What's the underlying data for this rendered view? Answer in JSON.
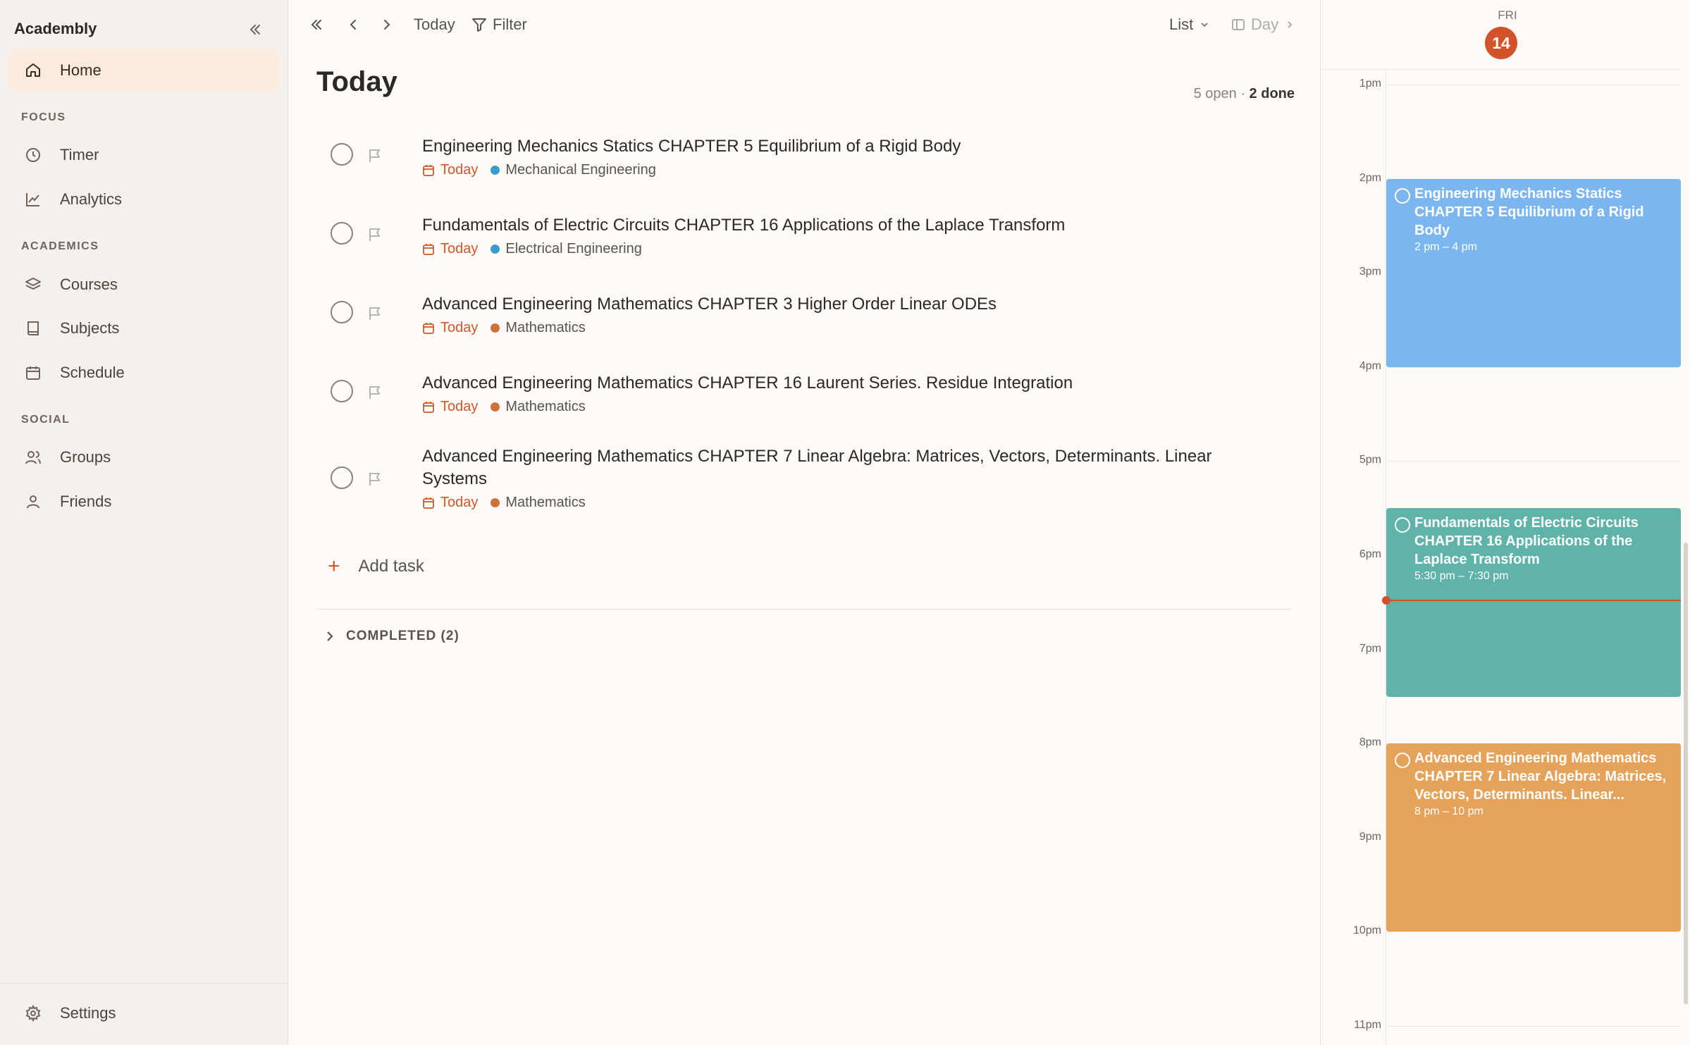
{
  "app": {
    "brand": "Academbly"
  },
  "sidebar": {
    "home": "Home",
    "sections": {
      "focus": "FOCUS",
      "academics": "ACADEMICS",
      "social": "SOCIAL"
    },
    "timer": "Timer",
    "analytics": "Analytics",
    "courses": "Courses",
    "subjects": "Subjects",
    "schedule": "Schedule",
    "groups": "Groups",
    "friends": "Friends",
    "settings": "Settings"
  },
  "toolbar": {
    "today": "Today",
    "filter": "Filter",
    "view": "List",
    "day": "Day"
  },
  "main": {
    "title": "Today",
    "open_count": "5 open",
    "separator": "·",
    "done_count": "2 done",
    "add_task": "Add task",
    "completed": "COMPLETED (2)"
  },
  "tasks": [
    {
      "title": "Engineering Mechanics Statics CHAPTER 5 Equilibrium of a Rigid Body",
      "due": "Today",
      "subject": "Mechanical Engineering",
      "color": "#3b9ac9"
    },
    {
      "title": "Fundamentals of Electric Circuits CHAPTER 16 Applications of the Laplace Transform",
      "due": "Today",
      "subject": "Electrical Engineering",
      "color": "#3b9ac9"
    },
    {
      "title": "Advanced Engineering Mathematics CHAPTER 3 Higher Order Linear ODEs",
      "due": "Today",
      "subject": "Mathematics",
      "color": "#d0703a"
    },
    {
      "title": "Advanced Engineering Mathematics CHAPTER 16 Laurent Series. Residue Integration",
      "due": "Today",
      "subject": "Mathematics",
      "color": "#d0703a"
    },
    {
      "title": "Advanced Engineering Mathematics CHAPTER 7 Linear Algebra: Matrices, Vectors, Determinants. Linear Systems",
      "due": "Today",
      "subject": "Mathematics",
      "color": "#d0703a"
    }
  ],
  "calendar": {
    "dow": "FRI",
    "date": "14",
    "hours": [
      "1pm",
      "2pm",
      "3pm",
      "4pm",
      "5pm",
      "6pm",
      "7pm",
      "8pm",
      "9pm",
      "10pm",
      "11pm"
    ],
    "events": [
      {
        "title": "Engineering Mechanics Statics CHAPTER 5 Equilibrium of a Rigid Body",
        "time": "2 pm – 4 pm",
        "color": "#7bb6f0"
      },
      {
        "title": "Fundamentals of Electric Circuits CHAPTER 16 Applications of the Laplace Transform",
        "time": "5:30 pm – 7:30 pm",
        "color": "#5fb3a9"
      },
      {
        "title": "Advanced Engineering Mathematics CHAPTER 7 Linear Algebra: Matrices, Vectors, Determinants. Linear...",
        "time": "8 pm – 10 pm",
        "color": "#e5a25a"
      }
    ]
  },
  "colors": {
    "accent": "#d2522a",
    "sidebar_bg": "#f5f0eb",
    "active_bg": "#fcebdd"
  }
}
